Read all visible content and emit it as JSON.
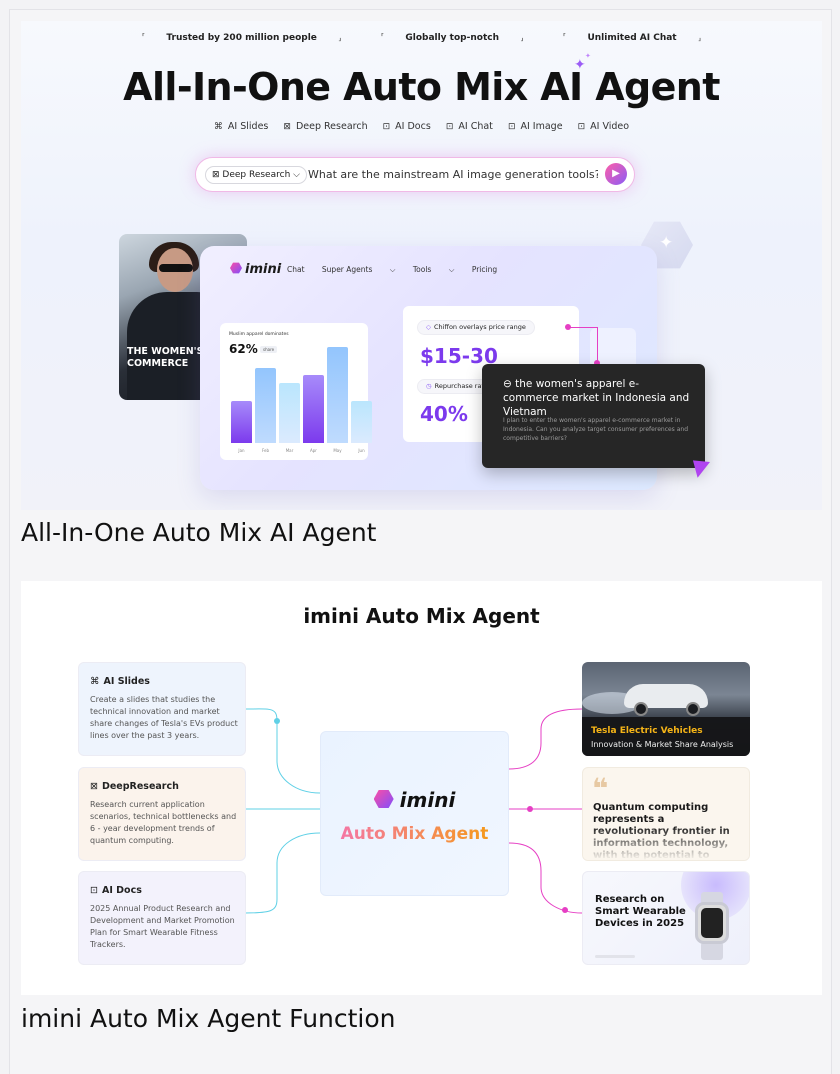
{
  "hero": {
    "trust_items": [
      "Trusted by 200 million people",
      "Globally top-notch",
      "Unlimited AI Chat"
    ],
    "title": "All-In-One Auto Mix AI Agent",
    "features": [
      {
        "icon": "slides-icon",
        "glyph": "⌘",
        "label": "AI Slides"
      },
      {
        "icon": "research-icon",
        "glyph": "⊠",
        "label": "Deep Research"
      },
      {
        "icon": "docs-icon",
        "glyph": "⊡",
        "label": "AI Docs"
      },
      {
        "icon": "chat-icon",
        "glyph": "⊡",
        "label": "AI Chat"
      },
      {
        "icon": "image-icon",
        "glyph": "⊡",
        "label": "AI Image"
      },
      {
        "icon": "video-icon",
        "glyph": "⊡",
        "label": "AI Video"
      }
    ],
    "search": {
      "mode": "Deep Research",
      "query": "What are the mainstream AI image generation tools?"
    },
    "mock": {
      "brand": "imini",
      "nav": [
        "Chat",
        "Super Agents",
        "Tools",
        "Pricing"
      ],
      "photo_caption": "THE WOMEN'S E-COMMERCE",
      "chart": {
        "note": "Muslim apparel dominates",
        "percent": "62%",
        "badge": "share",
        "months": [
          "Jan",
          "Feb",
          "Mar",
          "Apr",
          "May",
          "Jun"
        ],
        "values": [
          0.44,
          0.78,
          0.63,
          0.71,
          1.0,
          0.44
        ]
      },
      "stats": {
        "pill1": "Chiffon overlays price range",
        "price": "$15-30",
        "pill2": "Repurchase rate",
        "rate": "40%"
      },
      "tip": {
        "title": "the women's apparel e-commerce market in Indonesia and Vietnam",
        "body": "I plan to enter the women's apparel e-commerce market in Indonesia. Can you analyze target consumer preferences and competitive barriers?"
      }
    },
    "caption": "All-In-One Auto Mix AI Agent"
  },
  "func": {
    "title": "imini Auto Mix Agent",
    "left_cards": [
      {
        "icon": "slides-icon",
        "glyph": "⌘",
        "title": "AI Slides",
        "body": "Create a slides that studies the technical innovation and market share changes of Tesla's EVs product lines over the past 3 years."
      },
      {
        "icon": "research-icon",
        "glyph": "⊠",
        "title": "DeepResearch",
        "body": "Research current application scenarios, technical bottlenecks and 6 - year development trends of quantum computing."
      },
      {
        "icon": "docs-icon",
        "glyph": "⊡",
        "title": "AI Docs",
        "body": "2025 Annual Product Research and Development and Market Promotion Plan for Smart Wearable Fitness Trackers."
      }
    ],
    "center": {
      "brand": "imini",
      "subtitle": "Auto Mix Agent"
    },
    "tesla": {
      "title": "Tesla Electric Vehicles",
      "subtitle": "Innovation & Market Share Analysis"
    },
    "quote": {
      "text": "Quantum computing represents a revolutionary frontier in information technology, with the potential to transform"
    },
    "wearable": {
      "text": "Research on Smart Wearable Devices in 2025"
    },
    "caption": "imini Auto Mix Agent Function"
  },
  "colors": {
    "accent_pink": "#e63fc4",
    "accent_purple": "#7c3aed",
    "connector_cyan": "#5fd0e6"
  }
}
